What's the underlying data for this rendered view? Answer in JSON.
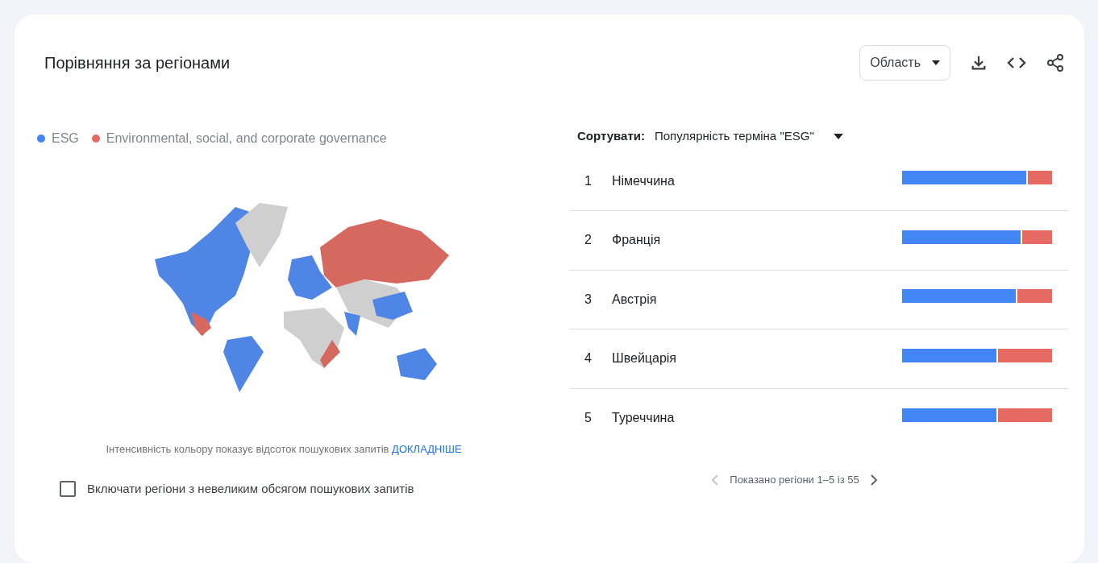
{
  "title": "Порівняння за регіонами",
  "toolbar": {
    "dropdown": "Область"
  },
  "legend": [
    {
      "label": "ESG",
      "color": "#4285f4"
    },
    {
      "label": "Environmental, social, and corporate governance",
      "color": "#e66a62"
    }
  ],
  "map_note": {
    "text": "Інтенсивність кольору показує відсоток пошукових запитів",
    "link": "ДОКЛАДНІШЕ"
  },
  "low_volume_checkbox": {
    "label": "Включати регіони з невеликим обсягом пошукових запитів",
    "checked": false
  },
  "sort": {
    "label": "Сортувати:",
    "value": "Популярність терміна \"ESG\""
  },
  "regions": [
    {
      "rank": "1",
      "name": "Німеччина",
      "level": 0.84
    },
    {
      "rank": "2",
      "name": "Франція",
      "level": 0.8
    },
    {
      "rank": "3",
      "name": "Австрія",
      "level": 0.77
    },
    {
      "rank": "4",
      "name": "Швейцарія",
      "level": 0.64
    },
    {
      "rank": "5",
      "name": "Туреччина",
      "level": 0.64
    }
  ],
  "pagination": {
    "text": "Показано регіони 1–5 із 55",
    "prev_disabled": true,
    "next_disabled": false
  }
}
